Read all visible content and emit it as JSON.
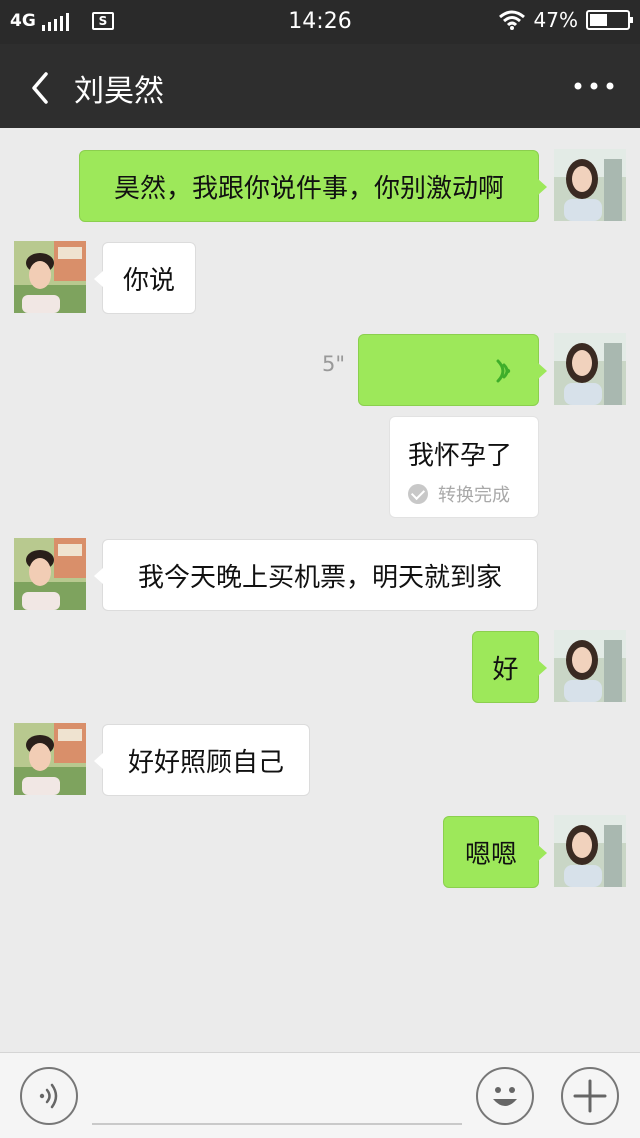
{
  "status_bar": {
    "network": "4G",
    "sim_label": "S",
    "time": "14:26",
    "battery_percent": "47%",
    "battery_level": 0.47
  },
  "header": {
    "contact_name": "刘昊然"
  },
  "messages": [
    {
      "side": "out",
      "type": "text",
      "text": "昊然，我跟你说件事，你别激动啊"
    },
    {
      "side": "in",
      "type": "text",
      "text": "你说"
    },
    {
      "side": "out",
      "type": "voice",
      "duration": "5\""
    },
    {
      "side": "out",
      "type": "transcript",
      "text": "我怀孕了",
      "status": "转换完成"
    },
    {
      "side": "in",
      "type": "text",
      "text": "我今天晚上买机票，明天就到家"
    },
    {
      "side": "out",
      "type": "text",
      "text": "好"
    },
    {
      "side": "in",
      "type": "text",
      "text": "好好照顾自己"
    },
    {
      "side": "out",
      "type": "text",
      "text": "嗯嗯"
    }
  ],
  "input_bar": {
    "text_value": ""
  },
  "icons": {
    "back": "chevron-left-icon",
    "more": "more-horizontal-icon",
    "voice": "voice-input-icon",
    "emoji": "emoji-icon",
    "plus": "plus-icon",
    "wave": "voice-wave-icon",
    "check": "check-icon"
  },
  "colors": {
    "outgoing_bubble": "#9de85a",
    "incoming_bubble": "#ffffff",
    "header_bg": "#2e2e2e",
    "chat_bg": "#ebebeb",
    "wave_green": "#3fae2a"
  }
}
